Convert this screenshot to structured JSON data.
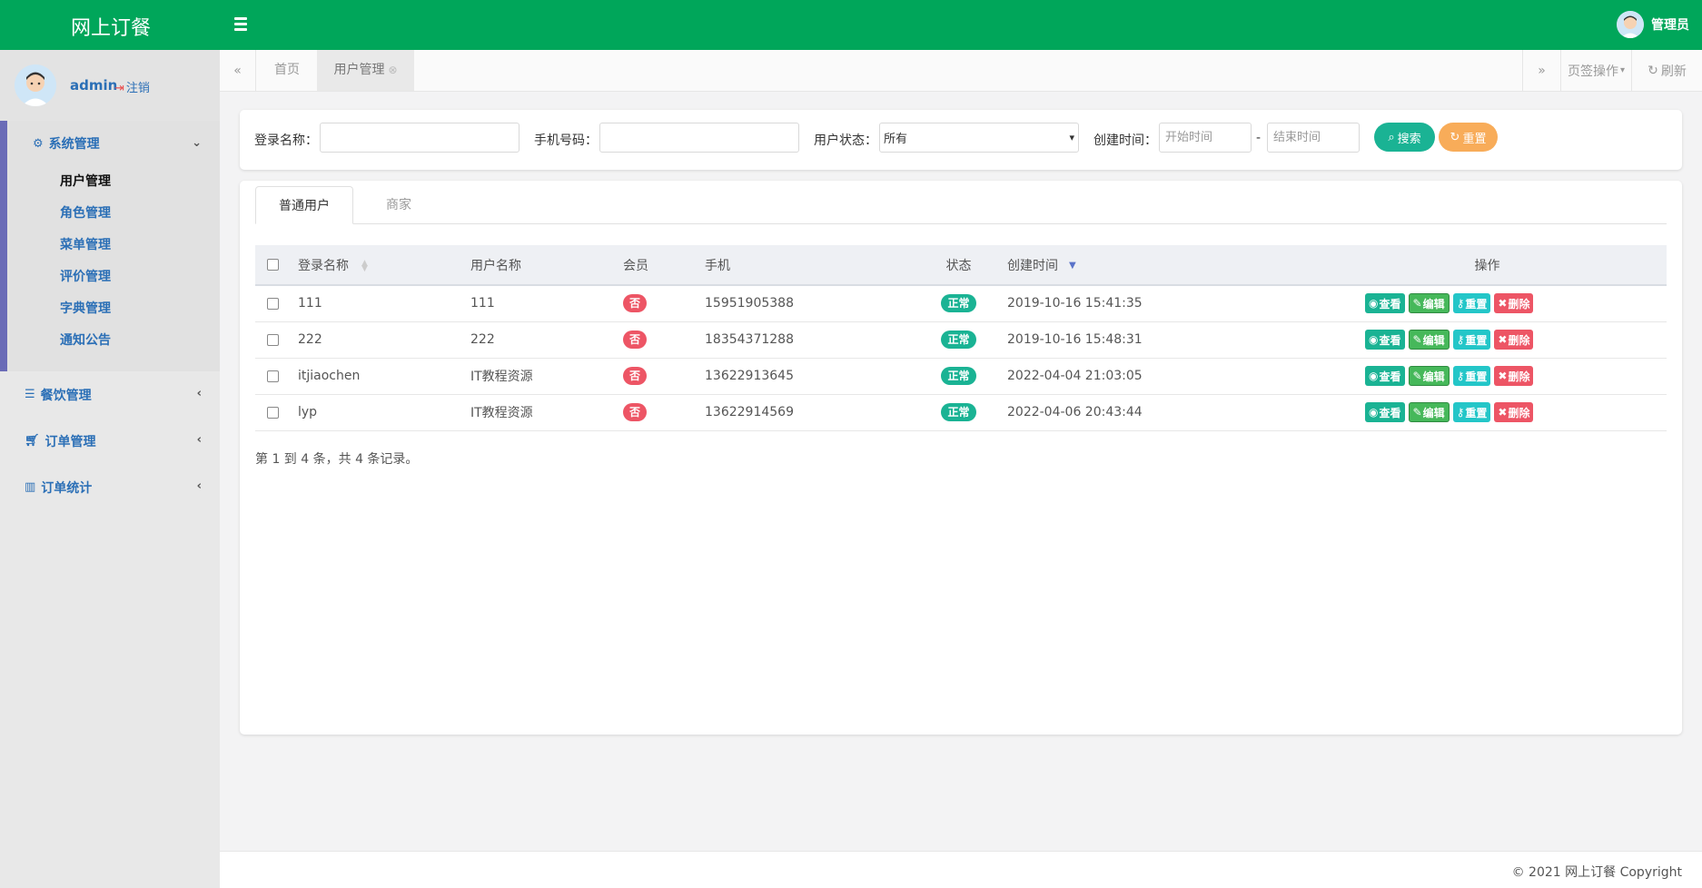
{
  "header": {
    "brand": "网上订餐",
    "user_label": "管理员"
  },
  "sidebar": {
    "user": {
      "name": "admin",
      "logout": "注销"
    },
    "system_menu": {
      "label": "系统管理",
      "items": [
        {
          "label": "用户管理"
        },
        {
          "label": "角色管理"
        },
        {
          "label": "菜单管理"
        },
        {
          "label": "评价管理"
        },
        {
          "label": "字典管理"
        },
        {
          "label": "通知公告"
        }
      ]
    },
    "other_menus": [
      {
        "label": "餐饮管理"
      },
      {
        "label": "订单管理"
      },
      {
        "label": "订单统计"
      }
    ]
  },
  "tabs": {
    "home": "首页",
    "active": "用户管理",
    "ops": "页签操作",
    "refresh": "刷新"
  },
  "search": {
    "login_name_label": "登录名称：",
    "phone_label": "手机号码：",
    "status_label": "用户状态：",
    "status_value": "所有",
    "created_label": "创建时间：",
    "start_placeholder": "开始时间",
    "end_placeholder": "结束时间",
    "range_sep": "-",
    "search_btn": "搜索",
    "reset_btn": "重置"
  },
  "panel_tabs": {
    "normal": "普通用户",
    "merchant": "商家"
  },
  "table": {
    "columns": [
      "登录名称",
      "用户名称",
      "会员",
      "手机",
      "状态",
      "创建时间",
      "操作"
    ],
    "action_labels": {
      "view": "查看",
      "edit": "编辑",
      "reset": "重置",
      "delete": "删除"
    },
    "rows": [
      {
        "login": "111",
        "name": "111",
        "member": "否",
        "phone": "15951905388",
        "status": "正常",
        "created": "2019-10-16 15:41:35"
      },
      {
        "login": "222",
        "name": "222",
        "member": "否",
        "phone": "18354371288",
        "status": "正常",
        "created": "2019-10-16 15:48:31"
      },
      {
        "login": "itjiaochen",
        "name": "IT教程资源",
        "member": "否",
        "phone": "13622913645",
        "status": "正常",
        "created": "2022-04-04 21:03:05"
      },
      {
        "login": "lyp",
        "name": "IT教程资源",
        "member": "否",
        "phone": "13622914569",
        "status": "正常",
        "created": "2022-04-06 20:43:44"
      }
    ],
    "pagination": "第 1 到 4 条，共 4 条记录。"
  },
  "footer": {
    "copyright": "© 2021 网上订餐 Copyright"
  },
  "colors": {
    "header": "#00a65a",
    "accent_teal": "#1ab394",
    "danger": "#ed5565",
    "warning": "#f8ac59",
    "info": "#23c6c8",
    "sidebar_bar": "#6a6bb7"
  }
}
